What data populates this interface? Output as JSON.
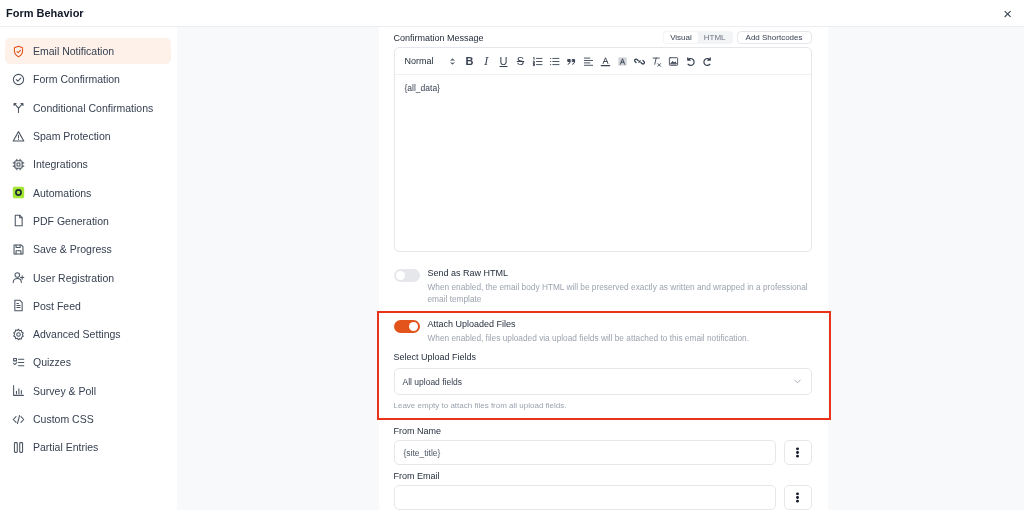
{
  "window": {
    "title": "Form Behavior",
    "close": "×"
  },
  "sidebar": {
    "items": [
      {
        "label": "Email Notification",
        "kind": "shield",
        "selected": true
      },
      {
        "label": "Form Confirmation",
        "kind": "check",
        "selected": false
      },
      {
        "label": "Conditional Confirmations",
        "kind": "branch",
        "selected": false
      },
      {
        "label": "Spam Protection",
        "kind": "warning",
        "selected": false
      },
      {
        "label": "Integrations",
        "kind": "chip",
        "selected": false
      },
      {
        "label": "Automations",
        "kind": "automation",
        "selected": false
      },
      {
        "label": "PDF Generation",
        "kind": "file",
        "selected": false
      },
      {
        "label": "Save & Progress",
        "kind": "save",
        "selected": false
      },
      {
        "label": "User Registration",
        "kind": "user",
        "selected": false
      },
      {
        "label": "Post Feed",
        "kind": "doc",
        "selected": false
      },
      {
        "label": "Advanced Settings",
        "kind": "gear",
        "selected": false
      },
      {
        "label": "Quizzes",
        "kind": "quiz",
        "selected": false
      },
      {
        "label": "Survey & Poll",
        "kind": "chart",
        "selected": false
      },
      {
        "label": "Custom CSS",
        "kind": "code",
        "selected": false
      },
      {
        "label": "Partial Entries",
        "kind": "columns",
        "selected": false
      }
    ]
  },
  "editor": {
    "label": "Confirmation Message",
    "modes": [
      {
        "label": "Visual",
        "selected": true
      },
      {
        "label": "HTML",
        "selected": false
      }
    ],
    "shortcodes_button": "Add Shortcodes",
    "format": "Normal",
    "toolbar": [
      {
        "kind": "bold",
        "label": "B"
      },
      {
        "kind": "italic",
        "label": "I"
      },
      {
        "kind": "underline",
        "label": "U"
      },
      {
        "kind": "strike",
        "label": "S"
      },
      {
        "kind": "ordered-list"
      },
      {
        "kind": "bullet-list"
      },
      {
        "kind": "quote"
      },
      {
        "kind": "align"
      },
      {
        "kind": "text-color"
      },
      {
        "kind": "highlight"
      },
      {
        "kind": "link"
      },
      {
        "kind": "clear-format"
      },
      {
        "kind": "image"
      },
      {
        "kind": "undo"
      },
      {
        "kind": "redo"
      }
    ],
    "content": "{all_data}"
  },
  "toggles": [
    {
      "label": "Send as Raw HTML",
      "description": "When enabled, the email body HTML will be preserved exactly as written and wrapped in a professional email template",
      "on": false,
      "highlighted": false
    },
    {
      "label": "Attach Uploaded Files",
      "description": "When enabled, files uploaded via upload fields will be attached to this email notification.",
      "on": true,
      "highlighted": true,
      "select": {
        "label": "Select Upload Fields",
        "value": "All upload fields",
        "help": "Leave empty to attach files from all upload fields."
      }
    }
  ],
  "fields": [
    {
      "label": "From Name",
      "value": "{site_title}"
    },
    {
      "label": "From Email"
    }
  ]
}
